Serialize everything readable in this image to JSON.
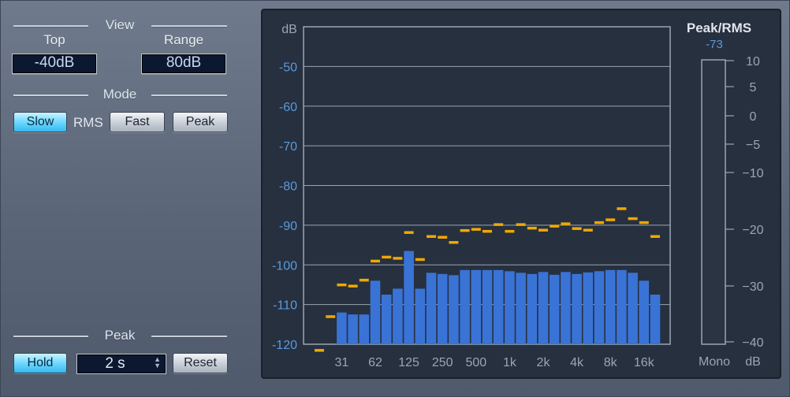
{
  "view": {
    "title": "View",
    "top_label": "Top",
    "top_value": "-40dB",
    "range_label": "Range",
    "range_value": "80dB"
  },
  "mode": {
    "title": "Mode",
    "slow": "Slow",
    "rms": "RMS",
    "fast": "Fast",
    "peak": "Peak"
  },
  "peak": {
    "title": "Peak",
    "hold": "Hold",
    "hold_time": "2 s",
    "reset": "Reset"
  },
  "meter": {
    "title": "Peak/RMS",
    "value": "-73",
    "scale": [
      "10",
      "5",
      "0",
      "−5",
      "−10",
      "−20",
      "−30",
      "−40"
    ],
    "mono_label": "Mono",
    "db_label": "dB"
  },
  "colors": {
    "bar": "#3a73d6",
    "peak_marker": "#f0a800",
    "label_blue": "#5a9ae0"
  },
  "chart_data": {
    "type": "bar",
    "ylabel": "dB",
    "ylim": [
      -120,
      -40
    ],
    "y_ticks": [
      "-50",
      "-60",
      "-70",
      "-80",
      "-90",
      "-100",
      "-110",
      "-120"
    ],
    "x_ticks": [
      "31",
      "62",
      "125",
      "250",
      "500",
      "1k",
      "2k",
      "4k",
      "8k",
      "16k"
    ],
    "bands": 31,
    "rms": [
      null,
      null,
      -112,
      -112.5,
      -112.5,
      -104,
      -107.5,
      -106,
      -96.5,
      -106,
      -102,
      -102.3,
      -102.6,
      -101.3,
      -101.3,
      -101.3,
      -101.3,
      -101.6,
      -102,
      -102.3,
      -101.8,
      -102.5,
      -101.8,
      -102.3,
      -101.9,
      -101.6,
      -101.3,
      -101.3,
      -102,
      -104,
      -107.5
    ],
    "peak": [
      -121.5,
      -113,
      -105,
      -105.3,
      -103.8,
      -99,
      -98,
      -98.3,
      -91.8,
      -98.6,
      -92.8,
      -93,
      -94.3,
      -91.3,
      -91,
      -91.5,
      -89.8,
      -91.5,
      -89.8,
      -90.7,
      -91.2,
      -90.2,
      -89.6,
      -90.8,
      -91.2,
      -89.3,
      -88.6,
      -85.8,
      -88.3,
      -89.3,
      -92.8
    ]
  }
}
